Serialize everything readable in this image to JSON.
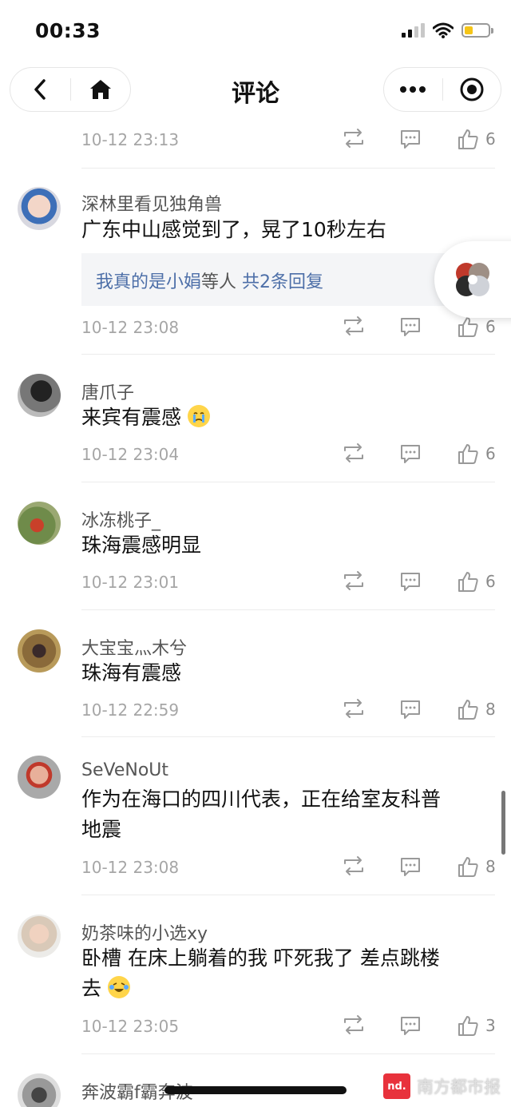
{
  "status_bar": {
    "time": "00:33",
    "battery_level": 0.35
  },
  "nav": {
    "title": "评论"
  },
  "comments": [
    {
      "time": "10-12 23:13",
      "likes": "6"
    },
    {
      "user": "深林里看见独角兽",
      "text": "广东中山感觉到了，晃了10秒左右",
      "reply_user": "我真的是小娟",
      "reply_mid": "等人",
      "reply_count": "共2条回复",
      "time": "10-12 23:08",
      "likes": "6"
    },
    {
      "user": "唐爪子",
      "text": "来宾有震感",
      "time": "10-12 23:04",
      "likes": "6"
    },
    {
      "user": "冰冻桃子_",
      "text": "珠海震感明显",
      "time": "10-12 23:01",
      "likes": "6"
    },
    {
      "user": "大宝宝灬木兮",
      "text": "珠海有震感",
      "time": "10-12 22:59",
      "likes": "8"
    },
    {
      "user": "SeVeNoUt",
      "text": "作为在海口的四川代表，正在给室友科普",
      "text2": "地震",
      "time": "10-12 23:08",
      "likes": "8"
    },
    {
      "user": "奶茶味的小选xy",
      "text": "卧槽 在床上躺着的我 吓死我了 差点跳楼",
      "text2": "去",
      "time": "10-12 23:05",
      "likes": "3"
    },
    {
      "user": "奔波霸f霸奔波"
    }
  ],
  "watermark": {
    "logo": "nd.",
    "text": "南方都市报"
  }
}
